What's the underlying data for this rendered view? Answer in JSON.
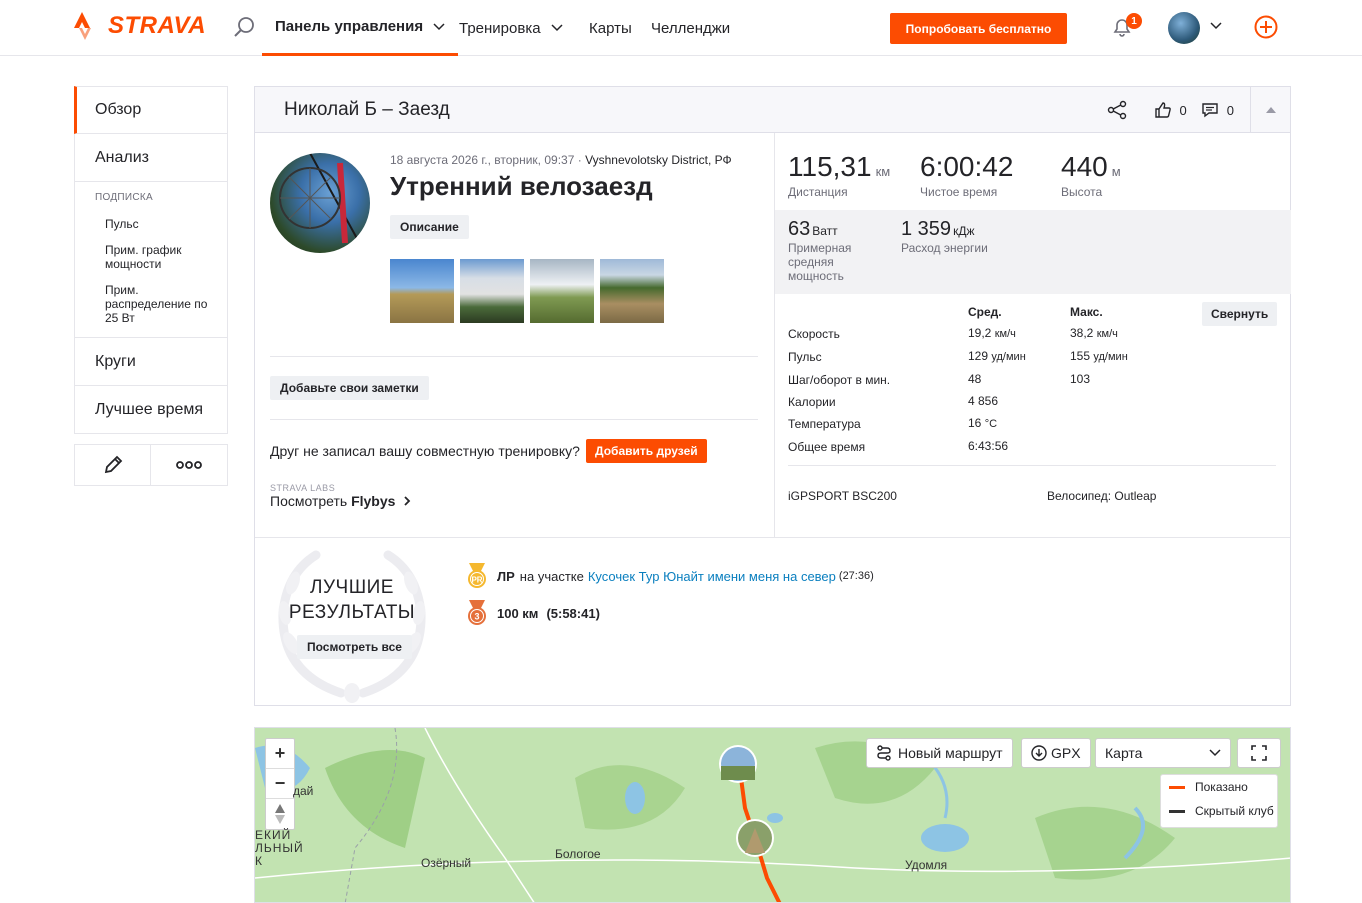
{
  "app": {
    "brand": "STRAVA",
    "brand_color": "#fc4c02"
  },
  "nav": {
    "items": [
      {
        "label": "Панель управления",
        "has_chevron": true,
        "active": true
      },
      {
        "label": "Тренировка",
        "has_chevron": true
      },
      {
        "label": "Карты"
      },
      {
        "label": "Челленджи"
      }
    ],
    "try_free": "Попробовать бесплатно",
    "notifications_count": "1"
  },
  "sidebar": {
    "items": [
      "Обзор",
      "Анализ"
    ],
    "sub_title": "ПОДПИСКА",
    "sub_items": [
      "Пульс",
      "Прим. график мощности",
      "Прим. распределение по 25 Вт"
    ],
    "items2": [
      "Круги",
      "Лучшее время"
    ]
  },
  "activity": {
    "header_title": "Николай Б – Заезд",
    "likes": "0",
    "comments": "0",
    "date": "18 августа 2026 г., вторник, 09:37",
    "location": "Vyshnevolotsky District, РФ",
    "title": "Утренний велозаезд",
    "description_btn": "Описание",
    "notes_btn": "Добавьте свои заметки",
    "friend_text": "Друг не записал вашу совместную тренировку?",
    "add_friends": "Добавить друзей",
    "labs": "STRAVA LABS",
    "flybys_prefix": "Посмотреть",
    "flybys": "Flybys"
  },
  "stats": {
    "main": [
      {
        "value": "115,31",
        "unit": "км",
        "label": "Дистанция"
      },
      {
        "value": "6:00:42",
        "unit": "",
        "label": "Чистое время"
      },
      {
        "value": "440",
        "unit": "м",
        "label": "Высота"
      }
    ],
    "band": [
      {
        "value": "63",
        "unit": "Ватт",
        "label": "Примерная средняя мощность"
      },
      {
        "value": "1 359",
        "unit": "кДж",
        "label": "Расход энергии"
      }
    ],
    "col_avg": "Сред.",
    "col_max": "Макс.",
    "collapse_btn": "Свернуть",
    "rows": [
      {
        "label": "Скорость",
        "avg": "19,2",
        "avg_unit": "км/ч",
        "max": "38,2",
        "max_unit": "км/ч"
      },
      {
        "label": "Пульс",
        "avg": "129",
        "avg_unit": "уд/мин",
        "max": "155",
        "max_unit": "уд/мин"
      },
      {
        "label": "Шаг/оборот в мин.",
        "avg": "48",
        "avg_unit": "",
        "max": "103",
        "max_unit": ""
      },
      {
        "label": "Калории",
        "avg": "4 856",
        "avg_unit": "",
        "max": "",
        "max_unit": ""
      },
      {
        "label": "Температура",
        "avg": "16",
        "avg_unit": "°C",
        "max": "",
        "max_unit": ""
      },
      {
        "label": "Общее время",
        "avg": "6:43:56",
        "avg_unit": "",
        "max": "",
        "max_unit": ""
      }
    ],
    "device": "iGPSPORT BSC200",
    "bike_label": "Велосипед:",
    "bike": "Outleap"
  },
  "achievements": {
    "title_line1": "ЛУЧШИЕ",
    "title_line2": "РЕЗУЛЬТАТЫ",
    "see_all": "Посмотреть все",
    "pr_label": "ЛР",
    "pr_on": "на участке",
    "pr_segment": "Кусочек Тур Юнайт имени меня на север",
    "pr_time": "(27:36)",
    "second_distance": "100 км",
    "second_time": "(5:58:41)"
  },
  "map": {
    "new_route": "Новый маршрут",
    "gpx": "GPX",
    "map_type": "Карта",
    "legend": [
      {
        "label": "Показано",
        "color": "#fc4c02"
      },
      {
        "label": "Скрытый клуб",
        "color": "#333333"
      }
    ],
    "places": [
      "Озёрный",
      "Бологое",
      "Удомля",
      "дай",
      "ЕКИЙ",
      "ЛЬНЫЙ",
      "К"
    ]
  }
}
